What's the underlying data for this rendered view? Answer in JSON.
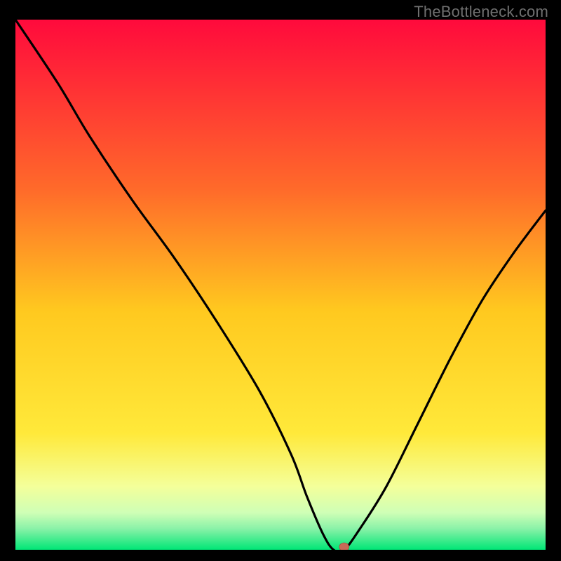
{
  "watermark": "TheBottleneck.com",
  "colors": {
    "topGradient": "#ff0a3c",
    "midGradient": "#ffd400",
    "lowGradient": "#f4ffb4",
    "bottomGradient": "#00e676",
    "curveStroke": "#000000",
    "marker": "#c96a57",
    "background": "#000000"
  },
  "chart_data": {
    "type": "line",
    "title": "",
    "xlabel": "",
    "ylabel": "",
    "xlim": [
      0,
      100
    ],
    "ylim": [
      0,
      100
    ],
    "grid": false,
    "legend": "none",
    "series": [
      {
        "name": "bottleneck-curve",
        "x": [
          0,
          8,
          14,
          22,
          30,
          38,
          46,
          52,
          55,
          58,
          60,
          62,
          65,
          70,
          76,
          82,
          88,
          94,
          100
        ],
        "values": [
          100,
          88,
          78,
          66,
          55,
          43,
          30,
          18,
          10,
          3,
          0,
          0,
          4,
          12,
          24,
          36,
          47,
          56,
          64
        ]
      }
    ],
    "marker": {
      "x": 62,
      "y": 0
    },
    "gradient_bands": [
      {
        "y_from": 100,
        "y_to": 50,
        "color_from": "#ff0a3c",
        "color_to": "#ffb400"
      },
      {
        "y_from": 50,
        "y_to": 15,
        "color_from": "#ffb400",
        "color_to": "#ffe400"
      },
      {
        "y_from": 15,
        "y_to": 5,
        "color_from": "#ffe400",
        "color_to": "#f0ffb0"
      },
      {
        "y_from": 5,
        "y_to": 0,
        "color_from": "#b0ffc0",
        "color_to": "#00e676"
      }
    ]
  }
}
